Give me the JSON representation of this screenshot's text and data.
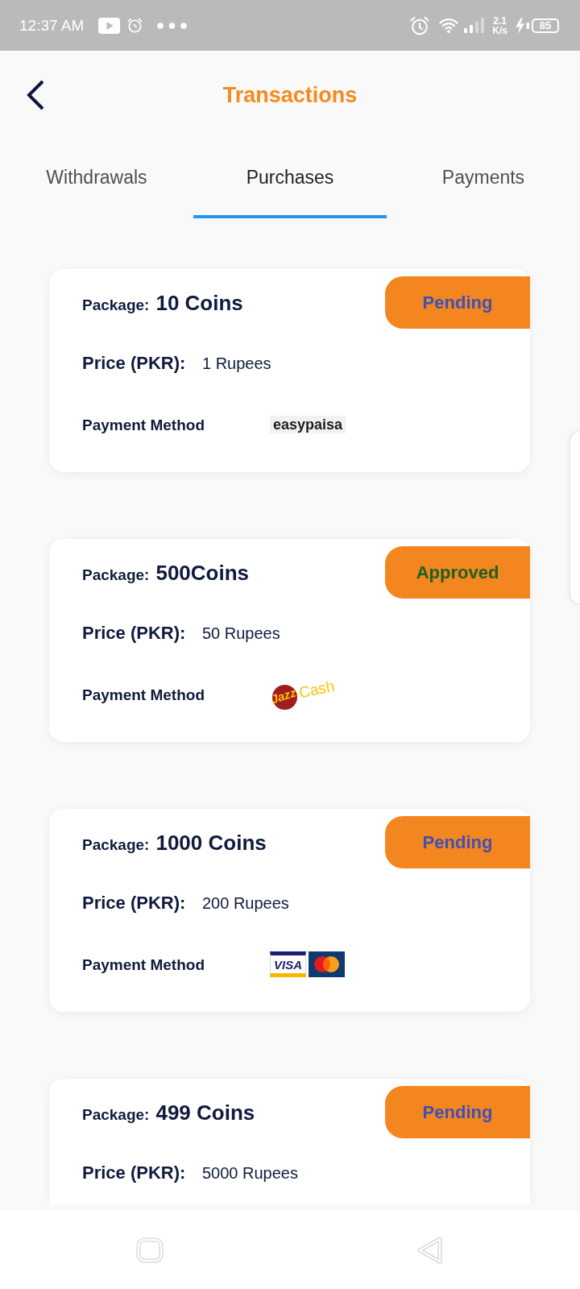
{
  "status_bar": {
    "time": "12:37 AM",
    "speed": "2.1",
    "speed_unit": "K/s",
    "battery": "85"
  },
  "header": {
    "title": "Transactions"
  },
  "tabs": [
    {
      "label": "Withdrawals",
      "selected": false
    },
    {
      "label": "Purchases",
      "selected": true
    },
    {
      "label": "Payments",
      "selected": false
    }
  ],
  "transactions": [
    {
      "package_label": "Package:",
      "package": "10 Coins",
      "status": {
        "label": "Pending",
        "kind": "pending"
      },
      "price_label": "Price (PKR):",
      "price": "1 Rupees",
      "payment_label": "Payment Method",
      "payment_logo": {
        "kind": "easypaisa",
        "texts": [
          "easypaisa"
        ]
      }
    },
    {
      "package_label": "Package:",
      "package": "500Coins",
      "status": {
        "label": "Approved",
        "kind": "approved"
      },
      "price_label": "Price (PKR):",
      "price": "50 Rupees",
      "payment_label": "Payment Method",
      "payment_logo": {
        "kind": "jazzcash",
        "texts": [
          "Jazz",
          "Cash"
        ]
      }
    },
    {
      "package_label": "Package:",
      "package": "1000 Coins",
      "status": {
        "label": "Pending",
        "kind": "pending"
      },
      "price_label": "Price (PKR):",
      "price": "200 Rupees",
      "payment_label": "Payment Method",
      "payment_logo": {
        "kind": "cards",
        "texts": [
          "VISA"
        ]
      }
    },
    {
      "package_label": "Package:",
      "package": "499 Coins",
      "status": {
        "label": "Pending",
        "kind": "pending"
      },
      "price_label": "Price (PKR):",
      "price": "5000 Rupees"
    }
  ]
}
